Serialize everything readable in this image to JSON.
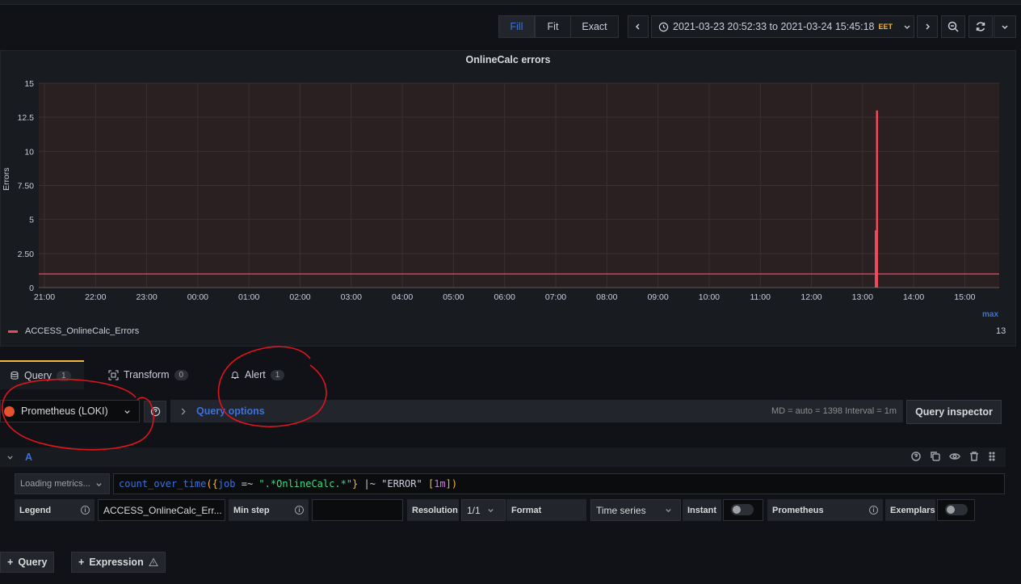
{
  "toolbar": {
    "zoom_modes": [
      "Fill",
      "Fit",
      "Exact"
    ],
    "time_range": "2021-03-23 20:52:33 to 2021-03-24 15:45:18",
    "timezone": "EET",
    "accent": "#3d71d9"
  },
  "panel": {
    "title": "OnlineCalc errors",
    "legend": {
      "max_header": "max",
      "series_name": "ACCESS_OnlineCalc_Errors",
      "max_value": "13"
    }
  },
  "chart_data": {
    "type": "line",
    "title": "OnlineCalc errors",
    "ylabel": "Errors",
    "xlabel": "",
    "ylim": [
      0,
      15
    ],
    "y_ticks": [
      "0",
      "2.50",
      "5",
      "7.50",
      "10",
      "12.5",
      "15"
    ],
    "x_ticks": [
      "21:00",
      "22:00",
      "23:00",
      "00:00",
      "01:00",
      "02:00",
      "03:00",
      "04:00",
      "05:00",
      "06:00",
      "07:00",
      "08:00",
      "09:00",
      "10:00",
      "11:00",
      "12:00",
      "13:00",
      "14:00",
      "15:00"
    ],
    "grid": true,
    "legend_position": "bottom-left",
    "series": [
      {
        "name": "ACCESS_OnlineCalc_Errors",
        "color": "#f2495c",
        "baseline": 1,
        "spike": {
          "time": "13:17",
          "value": 13
        }
      }
    ]
  },
  "tabs": [
    {
      "label": "Query",
      "count": "1",
      "icon": "database-icon"
    },
    {
      "label": "Transform",
      "count": "0",
      "icon": "transform-icon"
    },
    {
      "label": "Alert",
      "count": "1",
      "icon": "bell-icon"
    }
  ],
  "datasource": {
    "name": "Prometheus (LOKI)"
  },
  "query_options": {
    "label": "Query options",
    "info": "MD = auto = 1398    Interval = 1m"
  },
  "query_inspector": "Query inspector",
  "query": {
    "ref_id": "A",
    "metrics_button": "Loading metrics...",
    "expr_parts": [
      "count_over_time",
      "({",
      "job",
      " =~ ",
      "\".*OnlineCalc.*\"",
      "}",
      " |~ ",
      "\"ERROR\"",
      " [",
      "1m",
      "])"
    ],
    "legend_label": "Legend",
    "legend_value": "ACCESS_OnlineCalc_Err...",
    "min_step_label": "Min step",
    "resolution_label": "Resolution",
    "resolution_value": "1/1",
    "format_label": "Format",
    "format_value": "Time series",
    "instant_label": "Instant",
    "type_label": "Prometheus",
    "exemplars_label": "Exemplars"
  },
  "bottom": {
    "add_query": "Query",
    "add_expression": "Expression"
  }
}
